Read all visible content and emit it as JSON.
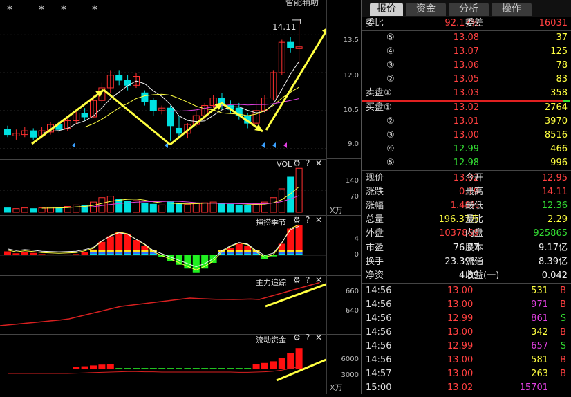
{
  "top_stars": [
    "*",
    "*",
    "*",
    "*"
  ],
  "chart_title": "智能辅助",
  "price_annotation": "14.11",
  "price_axis": [
    "13.5",
    "12.0",
    "10.5",
    "9.0"
  ],
  "vol_panel": {
    "title": "VOL",
    "axis": [
      "140",
      "70"
    ],
    "unit": "X万"
  },
  "season_panel": {
    "title": "捕捞季节",
    "axis": [
      "4",
      "0"
    ]
  },
  "main_track_panel": {
    "title": "主力追踪",
    "axis": [
      "660",
      "640"
    ]
  },
  "flow_panel": {
    "title": "流动资金",
    "axis": [
      "6000",
      "3000"
    ],
    "unit": "X万"
  },
  "panel_icons": {
    "gear": "⚙",
    "help": "?",
    "close": "✕"
  },
  "tabs": [
    "报价",
    "资金",
    "分析",
    "操作"
  ],
  "webi": {
    "label1": "委比",
    "value1": "92.17%",
    "label2": "委差",
    "value2": "16031"
  },
  "sell_orders": [
    {
      "level": "⑤",
      "price": "13.08",
      "vol": "37"
    },
    {
      "level": "④",
      "price": "13.07",
      "vol": "125"
    },
    {
      "level": "③",
      "price": "13.06",
      "vol": "78"
    },
    {
      "level": "②",
      "price": "13.05",
      "vol": "83"
    },
    {
      "level": "卖盘①",
      "price": "13.03",
      "vol": "358"
    }
  ],
  "buy_orders": [
    {
      "level": "买盘①",
      "price": "13.02",
      "vol": "2764"
    },
    {
      "level": "②",
      "price": "13.01",
      "vol": "3970"
    },
    {
      "level": "③",
      "price": "13.00",
      "vol": "8516"
    },
    {
      "level": "④",
      "price": "12.99",
      "vol": "466"
    },
    {
      "level": "⑤",
      "price": "12.98",
      "vol": "996"
    }
  ],
  "quote": [
    {
      "l1": "现价",
      "v1": "13.02",
      "l2": "今开",
      "v2": "12.95"
    },
    {
      "l1": "涨跌",
      "v1": "0.19",
      "l2": "最高",
      "v2": "14.11"
    },
    {
      "l1": "涨幅",
      "v1": "1.48%",
      "l2": "最低",
      "v2": "12.36"
    },
    {
      "l1": "总量",
      "v1": "196.37万",
      "l2": "量比",
      "v2": "2.29"
    },
    {
      "l1": "外盘",
      "v1": "1037869",
      "l2": "内盘",
      "v2": "925865"
    }
  ],
  "fundamentals": [
    {
      "l1": "市盈",
      "v1": "76.77",
      "l2": "股本",
      "v2": "9.17亿"
    },
    {
      "l1": "换手",
      "v1": "23.39%",
      "l2": "流通",
      "v2": "8.39亿"
    },
    {
      "l1": "净资",
      "v1": "4.89",
      "l2": "收益(一)",
      "v2": "0.042"
    }
  ],
  "ticks": [
    {
      "time": "14:56",
      "price": "13.00",
      "vol": "531",
      "side": "B"
    },
    {
      "time": "14:56",
      "price": "13.00",
      "vol": "971",
      "side": "B"
    },
    {
      "time": "14:56",
      "price": "12.99",
      "vol": "861",
      "side": "S"
    },
    {
      "time": "14:56",
      "price": "13.00",
      "vol": "342",
      "side": "B"
    },
    {
      "time": "14:56",
      "price": "12.99",
      "vol": "657",
      "side": "S"
    },
    {
      "time": "14:56",
      "price": "13.00",
      "vol": "581",
      "side": "B"
    },
    {
      "time": "14:57",
      "price": "13.00",
      "vol": "263",
      "side": "B"
    },
    {
      "time": "15:00",
      "price": "13.02",
      "vol": "15701",
      "side": ""
    }
  ],
  "chart_data": {
    "type": "candlestick",
    "price_axis_ticks": [
      13.5,
      12.0,
      10.5,
      9.0
    ],
    "price_high_label": 14.11,
    "candles": [
      {
        "o": 9.75,
        "c": 9.55,
        "h": 9.9,
        "l": 9.45
      },
      {
        "o": 9.5,
        "c": 9.6,
        "h": 9.75,
        "l": 9.35
      },
      {
        "o": 9.55,
        "c": 9.7,
        "h": 9.85,
        "l": 9.45
      },
      {
        "o": 9.7,
        "c": 9.45,
        "h": 9.8,
        "l": 9.35
      },
      {
        "o": 9.5,
        "c": 9.7,
        "h": 9.85,
        "l": 9.4
      },
      {
        "o": 9.65,
        "c": 9.95,
        "h": 10.05,
        "l": 9.55
      },
      {
        "o": 9.95,
        "c": 9.75,
        "h": 10.1,
        "l": 9.6
      },
      {
        "o": 9.8,
        "c": 10.1,
        "h": 10.2,
        "l": 9.7
      },
      {
        "o": 10.1,
        "c": 10.4,
        "h": 10.5,
        "l": 9.95
      },
      {
        "o": 10.4,
        "c": 10.25,
        "h": 10.6,
        "l": 10.1
      },
      {
        "o": 10.25,
        "c": 10.9,
        "h": 11.1,
        "l": 10.2
      },
      {
        "o": 10.9,
        "c": 11.4,
        "h": 11.6,
        "l": 10.8
      },
      {
        "o": 11.4,
        "c": 11.9,
        "h": 12.1,
        "l": 11.2
      },
      {
        "o": 11.9,
        "c": 11.7,
        "h": 12.1,
        "l": 11.5
      },
      {
        "o": 11.7,
        "c": 11.5,
        "h": 11.9,
        "l": 11.3
      },
      {
        "o": 11.5,
        "c": 11.85,
        "h": 12.0,
        "l": 11.4
      },
      {
        "o": 11.2,
        "c": 10.85,
        "h": 11.3,
        "l": 10.7
      },
      {
        "o": 10.9,
        "c": 10.5,
        "h": 11.0,
        "l": 10.3
      },
      {
        "o": 10.5,
        "c": 10.6,
        "h": 10.7,
        "l": 10.35
      },
      {
        "o": 10.6,
        "c": 9.9,
        "h": 10.7,
        "l": 9.3
      },
      {
        "o": 9.8,
        "c": 9.6,
        "h": 10.3,
        "l": 9.4
      },
      {
        "o": 9.6,
        "c": 9.95,
        "h": 10.0,
        "l": 9.4
      },
      {
        "o": 9.95,
        "c": 10.3,
        "h": 10.5,
        "l": 9.85
      },
      {
        "o": 10.3,
        "c": 10.7,
        "h": 10.8,
        "l": 10.15
      },
      {
        "o": 10.7,
        "c": 11.0,
        "h": 11.1,
        "l": 10.6
      },
      {
        "o": 11.0,
        "c": 10.7,
        "h": 11.2,
        "l": 10.55
      },
      {
        "o": 10.7,
        "c": 10.55,
        "h": 10.9,
        "l": 10.4
      },
      {
        "o": 10.6,
        "c": 10.3,
        "h": 10.8,
        "l": 10.15
      },
      {
        "o": 10.3,
        "c": 10.0,
        "h": 10.4,
        "l": 9.8
      },
      {
        "o": 10.0,
        "c": 10.5,
        "h": 10.9,
        "l": 9.9
      },
      {
        "o": 10.5,
        "c": 11.0,
        "h": 11.1,
        "l": 10.4
      },
      {
        "o": 11.0,
        "c": 12.0,
        "h": 12.1,
        "l": 10.9
      },
      {
        "o": 12.0,
        "c": 13.2,
        "h": 13.3,
        "l": 11.9
      },
      {
        "o": 13.2,
        "c": 13.0,
        "h": 13.4,
        "l": 12.8
      },
      {
        "o": 12.95,
        "c": 13.02,
        "h": 14.11,
        "l": 12.36
      }
    ]
  }
}
